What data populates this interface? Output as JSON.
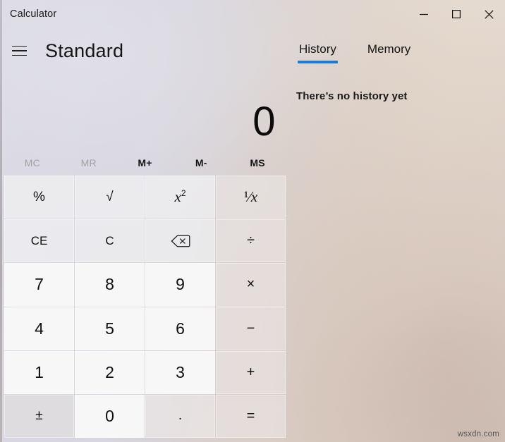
{
  "window": {
    "title": "Calculator",
    "controls": [
      {
        "name": "minimize",
        "label": "–"
      },
      {
        "name": "maximize",
        "label": "□"
      },
      {
        "name": "close",
        "label": "✕"
      }
    ]
  },
  "header": {
    "menu_icon": "hamburger-icon",
    "mode_title": "Standard"
  },
  "side_panel": {
    "tabs": [
      {
        "label": "History",
        "active": true
      },
      {
        "label": "Memory",
        "active": false
      }
    ],
    "history_empty_message": "There’s no history yet"
  },
  "display": {
    "expression": "",
    "value": "0"
  },
  "memory": {
    "buttons": [
      {
        "label": "MC",
        "enabled": false
      },
      {
        "label": "MR",
        "enabled": false
      },
      {
        "label": "M+",
        "enabled": true
      },
      {
        "label": "M-",
        "enabled": true
      },
      {
        "label": "MS",
        "enabled": true
      }
    ]
  },
  "keypad": {
    "rows": [
      [
        {
          "label": "%",
          "name": "percent-button"
        },
        {
          "label": "√",
          "name": "square-root-button"
        },
        {
          "label": "x²",
          "name": "square-button"
        },
        {
          "label": "¹⁄x",
          "name": "reciprocal-button"
        }
      ],
      [
        {
          "label": "CE",
          "name": "clear-entry-button"
        },
        {
          "label": "C",
          "name": "clear-button"
        },
        {
          "label": "⌫",
          "name": "backspace-button"
        },
        {
          "label": "÷",
          "name": "divide-button"
        }
      ],
      [
        {
          "label": "7",
          "name": "digit-7-button"
        },
        {
          "label": "8",
          "name": "digit-8-button"
        },
        {
          "label": "9",
          "name": "digit-9-button"
        },
        {
          "label": "×",
          "name": "multiply-button"
        }
      ],
      [
        {
          "label": "4",
          "name": "digit-4-button"
        },
        {
          "label": "5",
          "name": "digit-5-button"
        },
        {
          "label": "6",
          "name": "digit-6-button"
        },
        {
          "label": "−",
          "name": "subtract-button"
        }
      ],
      [
        {
          "label": "1",
          "name": "digit-1-button"
        },
        {
          "label": "2",
          "name": "digit-2-button"
        },
        {
          "label": "3",
          "name": "digit-3-button"
        },
        {
          "label": "+",
          "name": "add-button"
        }
      ],
      [
        {
          "label": "±",
          "name": "sign-toggle-button"
        },
        {
          "label": "0",
          "name": "digit-0-button"
        },
        {
          "label": ".",
          "name": "decimal-point-button"
        },
        {
          "label": "=",
          "name": "equals-button"
        }
      ]
    ]
  },
  "watermark": "wsxdn.com",
  "colors": {
    "accent_blue": "#1a7bd2",
    "text_primary": "#101010",
    "text_disabled": "#a3a1a3"
  }
}
